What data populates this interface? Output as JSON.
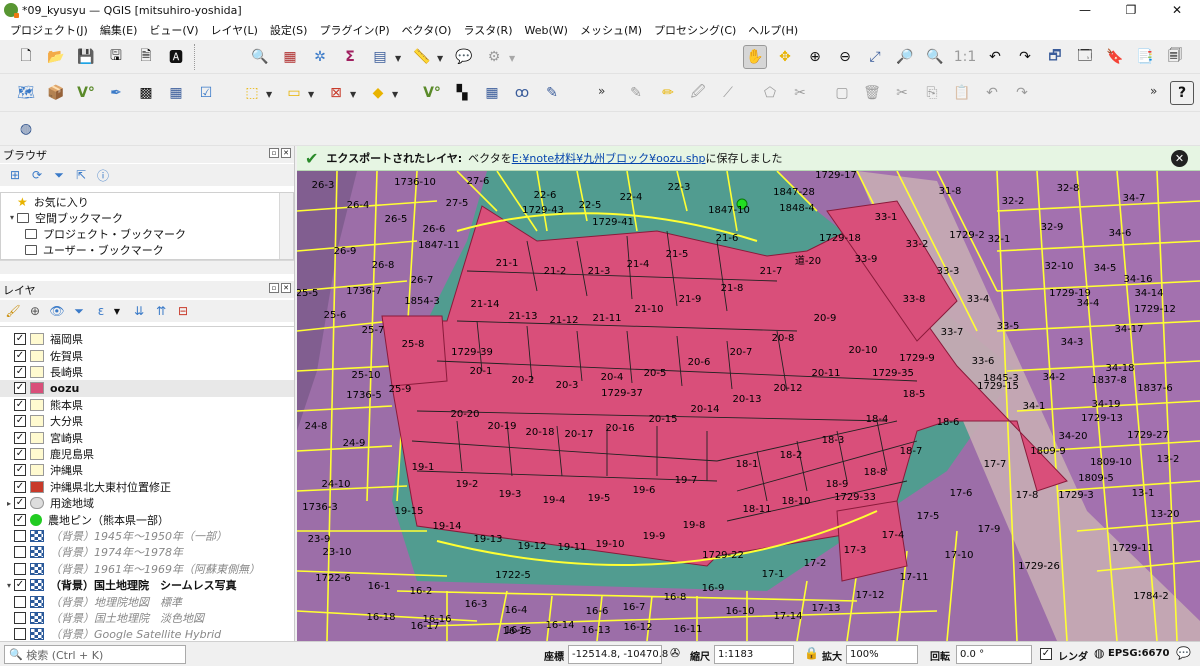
{
  "window": {
    "title": "*09_kyusyu — QGIS [mitsuhiro-yoshida]",
    "min": "—",
    "max": "❐",
    "close": "✕"
  },
  "menu": [
    "プロジェクト(J)",
    "編集(E)",
    "ビュー(V)",
    "レイヤ(L)",
    "設定(S)",
    "プラグイン(P)",
    "ベクタ(O)",
    "ラスタ(R)",
    "Web(W)",
    "メッシュ(M)",
    "プロセシング(C)",
    "ヘルプ(H)"
  ],
  "browser": {
    "title": "ブラウザ",
    "items": [
      "お気に入り",
      "空間ブックマーク",
      "プロジェクト・ブックマーク",
      "ユーザー・ブックマーク"
    ]
  },
  "layers": {
    "title": "レイヤ",
    "items": [
      {
        "label": "福岡県",
        "checked": true,
        "color": "#fffad0"
      },
      {
        "label": "佐賀県",
        "checked": true,
        "color": "#fffad0"
      },
      {
        "label": "長崎県",
        "checked": true,
        "color": "#fffad0"
      },
      {
        "label": "oozu",
        "checked": true,
        "color": "#d94f7a",
        "selected": true
      },
      {
        "label": "熊本県",
        "checked": true,
        "color": "#fffad0"
      },
      {
        "label": "大分県",
        "checked": true,
        "color": "#fffad0"
      },
      {
        "label": "宮崎県",
        "checked": true,
        "color": "#fffad0"
      },
      {
        "label": "鹿児島県",
        "checked": true,
        "color": "#fffad0"
      },
      {
        "label": "沖縄県",
        "checked": true,
        "color": "#fffad0"
      },
      {
        "label": "沖縄県北大東村位置修正",
        "checked": true,
        "color": "#c83a2a"
      },
      {
        "label": "用途地域",
        "checked": true,
        "color": "#dddddd"
      },
      {
        "label": "農地ピン（熊本県一部）",
        "checked": true,
        "color": "#22cc22"
      },
      {
        "label": "（背景）1945年～1950年（一部）",
        "checked": false,
        "muted": true
      },
      {
        "label": "（背景）1974年～1978年",
        "checked": false,
        "muted": true
      },
      {
        "label": "（背景）1961年～1969年（阿蘇東側無）",
        "checked": false,
        "muted": true
      },
      {
        "label": "（背景）国土地理院　シームレス写真",
        "checked": true,
        "bold": true
      },
      {
        "label": "（背景）地理院地図　標準",
        "checked": false,
        "muted": true
      },
      {
        "label": "（背景）国土地理院　淡色地図",
        "checked": false,
        "muted": true
      },
      {
        "label": "（背景）Google Satellite Hybrid",
        "checked": false,
        "muted": true
      }
    ]
  },
  "message": {
    "title": "エクスポートされたレイヤ:",
    "prefix": "ベクタを",
    "link": "E:¥note材料¥九州ブロック¥oozu.shp",
    "suffix": "に保存しました"
  },
  "status": {
    "search_placeholder": "検索 (Ctrl + K)",
    "coord_label": "座標",
    "coord_value": "-12514.8, -10470.8",
    "scale_label": "縮尺",
    "scale_value": "1:1183",
    "magnifier_label": "拡大",
    "magnifier_value": "100%",
    "rotation_label": "回転",
    "rotation_value": "0.0 °",
    "render_label": "レンダ",
    "crs": "EPSG:6670"
  },
  "colors": {
    "selected_parcel": "#d94f7a",
    "boundary": "#ffff33",
    "background_purple": "#9c6ea8",
    "background_teal": "#4d9e8e"
  },
  "map": {
    "parcels_selected": [
      "21-1",
      "21-2",
      "21-3",
      "21-4",
      "21-5",
      "21-6",
      "21-7",
      "21-8",
      "21-9",
      "21-10",
      "21-11",
      "21-12",
      "21-13",
      "21-14",
      "20-1",
      "20-2",
      "20-3",
      "20-4",
      "20-5",
      "20-6",
      "20-7",
      "20-8",
      "20-9",
      "20-10",
      "20-11",
      "20-12",
      "20-13",
      "20-14",
      "20-15",
      "20-16",
      "20-17",
      "20-18",
      "20-19",
      "20-20",
      "19-1",
      "19-2",
      "19-3",
      "19-4",
      "19-5",
      "19-6",
      "19-7",
      "19-8",
      "19-9",
      "19-10",
      "19-11",
      "19-12",
      "19-13",
      "19-14",
      "19-15",
      "18-1",
      "18-2",
      "18-3",
      "18-4",
      "18-5",
      "18-6",
      "18-7",
      "18-8",
      "18-9",
      "18-10",
      "18-11",
      "17-3",
      "17-4",
      "25-8",
      "33-8",
      "33-9",
      "1729-39",
      "1729-37",
      "1729-35",
      "1729-33",
      "1729-9",
      "1729-18",
      "道-20"
    ],
    "parcels_other": [
      "26-3",
      "1736-10",
      "27-6",
      "27-5",
      "26-4",
      "26-5",
      "26-6",
      "1847-11",
      "26-9",
      "26-8",
      "26-7",
      "25-5",
      "1736-7",
      "1854-3",
      "25-6",
      "25-7",
      "25-10",
      "25-9",
      "1736-5",
      "24-8",
      "24-9",
      "24-10",
      "1736-3",
      "23-9",
      "23-10",
      "1722-6",
      "1722-5",
      "16-1",
      "16-2",
      "16-3",
      "16-4",
      "16-5",
      "16-6",
      "16-7",
      "16-8",
      "16-9",
      "16-10",
      "16-11",
      "16-12",
      "16-13",
      "16-14",
      "16-15",
      "16-16",
      "16-17",
      "16-18",
      "17-1",
      "17-2",
      "17-5",
      "17-6",
      "17-7",
      "17-8",
      "17-9",
      "17-10",
      "17-11",
      "17-12",
      "17-13",
      "17-14",
      "1729-22",
      "1729-26",
      "1729-11",
      "1784-2",
      "22-6",
      "22-5",
      "22-4",
      "22-3",
      "1729-43",
      "1729-41",
      "1847-10",
      "1847-28",
      "1848-4",
      "1729-17",
      "33-1",
      "33-2",
      "33-3",
      "33-4",
      "33-5",
      "33-6",
      "33-7",
      "1729-2",
      "32-1",
      "32-2",
      "32-8",
      "32-9",
      "32-10",
      "31-8",
      "34-1",
      "34-2",
      "34-3",
      "34-4",
      "34-5",
      "34-6",
      "34-7",
      "34-14",
      "34-16",
      "34-17",
      "34-18",
      "34-19",
      "34-20",
      "1729-12",
      "1729-13",
      "1729-19",
      "1729-27",
      "1729-3",
      "1729-15",
      "1809-5",
      "1809-9",
      "1809-10",
      "1837-6",
      "1837-8",
      "1845-3",
      "13-1",
      "13-2",
      "13-20"
    ]
  }
}
